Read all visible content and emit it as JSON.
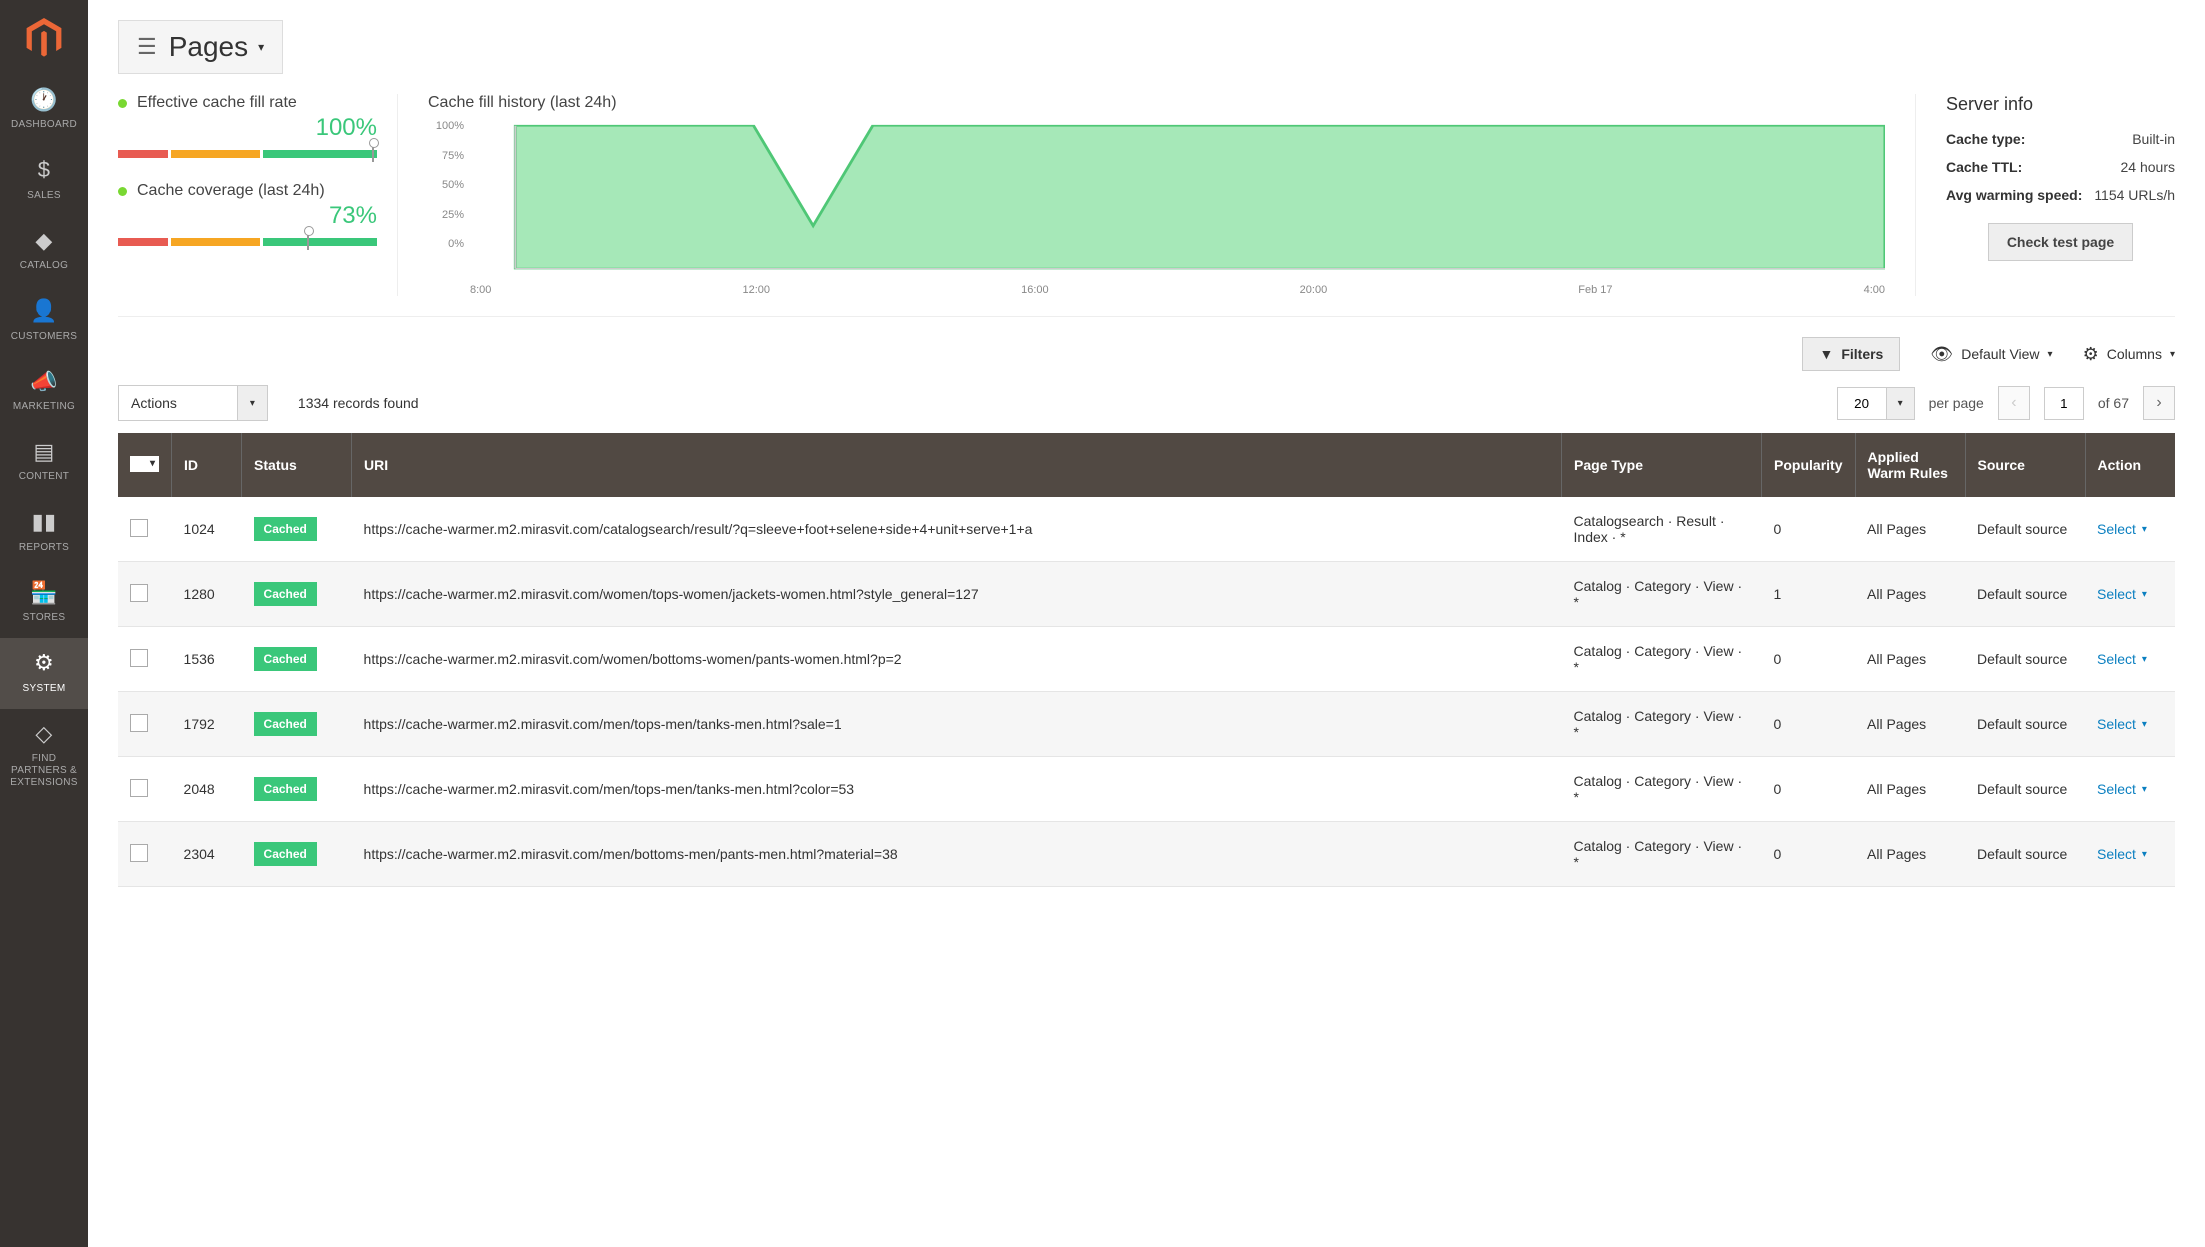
{
  "sidebar": {
    "items": [
      {
        "icon": "dashboard",
        "label": "DASHBOARD"
      },
      {
        "icon": "sales",
        "label": "SALES"
      },
      {
        "icon": "catalog",
        "label": "CATALOG"
      },
      {
        "icon": "customers",
        "label": "CUSTOMERS"
      },
      {
        "icon": "marketing",
        "label": "MARKETING"
      },
      {
        "icon": "content",
        "label": "CONTENT"
      },
      {
        "icon": "reports",
        "label": "REPORTS"
      },
      {
        "icon": "stores",
        "label": "STORES"
      },
      {
        "icon": "system",
        "label": "SYSTEM"
      },
      {
        "icon": "partners",
        "label": "FIND PARTNERS & EXTENSIONS"
      }
    ],
    "active_index": 8
  },
  "page_title": "Pages",
  "metrics": {
    "fill_rate": {
      "label": "Effective cache fill rate",
      "value": "100%",
      "marker_pct": 98
    },
    "coverage": {
      "label": "Cache coverage (last 24h)",
      "value": "73%",
      "marker_pct": 73
    }
  },
  "chart_data": {
    "type": "area",
    "title": "Cache fill history (last 24h)",
    "ylabel": "",
    "ylim": [
      0,
      100
    ],
    "y_ticks": [
      "100%",
      "75%",
      "50%",
      "25%",
      "0%"
    ],
    "x_ticks": [
      "8:00",
      "12:00",
      "16:00",
      "20:00",
      "Feb 17",
      "4:00"
    ],
    "x": [
      0,
      1,
      2,
      3,
      4,
      5,
      6,
      7,
      8,
      9,
      10,
      11,
      12,
      13,
      14,
      15,
      16,
      17,
      18,
      19,
      20,
      21,
      22,
      23
    ],
    "values": [
      100,
      100,
      100,
      100,
      100,
      30,
      100,
      100,
      100,
      100,
      100,
      100,
      100,
      100,
      100,
      100,
      100,
      100,
      100,
      100,
      100,
      100,
      100,
      100
    ]
  },
  "server_info": {
    "title": "Server info",
    "rows": [
      {
        "k": "Cache type:",
        "v": "Built-in"
      },
      {
        "k": "Cache TTL:",
        "v": "24 hours"
      },
      {
        "k": "Avg warming speed:",
        "v": "1154 URLs/h"
      }
    ],
    "check_btn": "Check test page"
  },
  "toolbar": {
    "filters": "Filters",
    "default_view": "Default View",
    "columns": "Columns"
  },
  "grid": {
    "actions_label": "Actions",
    "records_found": "1334 records found",
    "per_page": "20",
    "per_page_label": "per page",
    "page": "1",
    "of_label": "of 67"
  },
  "columns": {
    "chk": "",
    "id": "ID",
    "status": "Status",
    "uri": "URI",
    "type": "Page Type",
    "pop": "Popularity",
    "rules": "Applied Warm Rules",
    "source": "Source",
    "action": "Action"
  },
  "rows": [
    {
      "id": "1024",
      "status": "Cached",
      "uri": "https://cache-warmer.m2.mirasvit.com/catalogsearch/result/?q=sleeve+foot+selene+side+4+unit+serve+1+a",
      "type": "Catalogsearch · Result · Index · *",
      "pop": "0",
      "rules": "All Pages",
      "source": "Default source",
      "action": "Select"
    },
    {
      "id": "1280",
      "status": "Cached",
      "uri": "https://cache-warmer.m2.mirasvit.com/women/tops-women/jackets-women.html?style_general=127",
      "type": "Catalog · Category · View · *",
      "pop": "1",
      "rules": "All Pages",
      "source": "Default source",
      "action": "Select"
    },
    {
      "id": "1536",
      "status": "Cached",
      "uri": "https://cache-warmer.m2.mirasvit.com/women/bottoms-women/pants-women.html?p=2",
      "type": "Catalog · Category · View · *",
      "pop": "0",
      "rules": "All Pages",
      "source": "Default source",
      "action": "Select"
    },
    {
      "id": "1792",
      "status": "Cached",
      "uri": "https://cache-warmer.m2.mirasvit.com/men/tops-men/tanks-men.html?sale=1",
      "type": "Catalog · Category · View · *",
      "pop": "0",
      "rules": "All Pages",
      "source": "Default source",
      "action": "Select"
    },
    {
      "id": "2048",
      "status": "Cached",
      "uri": "https://cache-warmer.m2.mirasvit.com/men/tops-men/tanks-men.html?color=53",
      "type": "Catalog · Category · View · *",
      "pop": "0",
      "rules": "All Pages",
      "source": "Default source",
      "action": "Select"
    },
    {
      "id": "2304",
      "status": "Cached",
      "uri": "https://cache-warmer.m2.mirasvit.com/men/bottoms-men/pants-men.html?material=38",
      "type": "Catalog · Category · View · *",
      "pop": "0",
      "rules": "All Pages",
      "source": "Default source",
      "action": "Select"
    }
  ]
}
